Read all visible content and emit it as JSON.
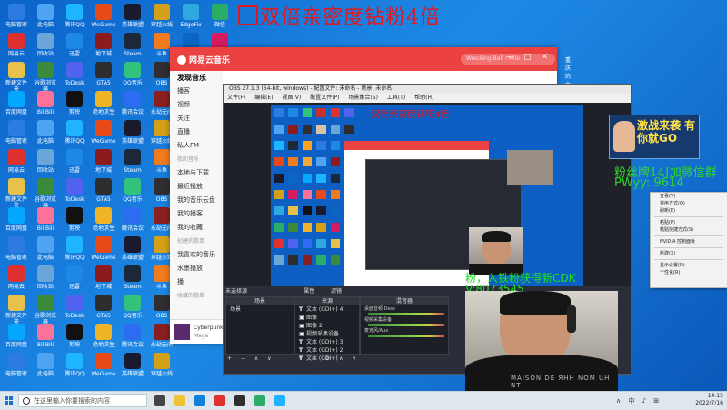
{
  "banner": {
    "text": "双倍亲密度钻粉4倍"
  },
  "desktop_icons": [
    {
      "label": "电脑管家",
      "color": "#2b7be0"
    },
    {
      "label": "此电脑",
      "color": "#4ea3f2"
    },
    {
      "label": "腾讯QQ",
      "color": "#1eb4ff"
    },
    {
      "label": "WeGame",
      "color": "#e64a19"
    },
    {
      "label": "英雄联盟",
      "color": "#1a1a2e"
    },
    {
      "label": "穿越火线",
      "color": "#d4a017"
    },
    {
      "label": "EdgeFix",
      "color": "#2fa8e0"
    },
    {
      "label": "微信",
      "color": "#2aae67"
    },
    {
      "label": "网易云",
      "color": "#e03131"
    },
    {
      "label": "回收站",
      "color": "#6aa6d8"
    },
    {
      "label": "迅雷",
      "color": "#1e88e5"
    },
    {
      "label": "地下城",
      "color": "#8c1c1c"
    },
    {
      "label": "Steam",
      "color": "#1b2838"
    },
    {
      "label": "斗鱼",
      "color": "#f27b1f"
    },
    {
      "label": "战网",
      "color": "#0a66c2"
    },
    {
      "label": "UU加速器",
      "color": "#d81b60"
    },
    {
      "label": "新建文件夹",
      "color": "#e8c14b"
    },
    {
      "label": "谷歌浏览器",
      "color": "#3a8a3a"
    },
    {
      "label": "ToDesk",
      "color": "#5063f0"
    },
    {
      "label": "GTA5",
      "color": "#2d2d2d"
    },
    {
      "label": "QQ音乐",
      "color": "#31c27c"
    },
    {
      "label": "OBS",
      "color": "#302e31"
    },
    {
      "label": "虎牙直播",
      "color": "#ffa31a"
    },
    {
      "label": "CS:GO",
      "color": "#f2a93b"
    },
    {
      "label": "百度网盘",
      "color": "#06a7ff"
    },
    {
      "label": "BiliBili",
      "color": "#fb7299"
    },
    {
      "label": "剪映",
      "color": "#111111"
    },
    {
      "label": "绝地求生",
      "color": "#f0b428"
    },
    {
      "label": "腾讯会议",
      "color": "#2d6cf0"
    },
    {
      "label": "永劫无间",
      "color": "#8a1f1f"
    },
    {
      "label": "APEX",
      "color": "#c9302c"
    },
    {
      "label": "原神",
      "color": "#d7c4a2"
    }
  ],
  "netease": {
    "app_title": "网易云音乐",
    "search_placeholder": "Wrecking Ball - Mile",
    "nav_label": "推荐",
    "user_name": "重庆的大吖",
    "sidebar": [
      "发现音乐",
      "播客",
      "视频",
      "关注",
      "直播",
      "私人FM"
    ],
    "my_music_title": "我的音乐",
    "my_music": [
      "本地与下载",
      "最近播放",
      "我的音乐云盘",
      "我的播客",
      "我的收藏"
    ],
    "created_title": "创建的歌单",
    "created": [
      "我喜欢的音乐",
      "水墨播放",
      "播"
    ],
    "collected_title": "收藏的歌单",
    "player_song": "Cyberpunk",
    "player_artist": "Maga"
  },
  "obs": {
    "title": "OBS 27.1.3 (64-bit, windows) - 配置文件: 未命名 - 场景: 未命名",
    "menu": [
      "文件(F)",
      "编辑(E)",
      "视图(V)",
      "配置文件(P)",
      "场景集合(S)",
      "工具(T)",
      "帮助(H)"
    ],
    "no_source": "未选择源",
    "tabs": [
      "属性",
      "滤镜"
    ],
    "scenes_title": "场景",
    "scenes": [
      "场景"
    ],
    "sources_title": "来源",
    "sources": [
      {
        "type": "T",
        "name": "文本 (GDI+) 4"
      },
      {
        "type": "▣",
        "name": "图像"
      },
      {
        "type": "▣",
        "name": "图像 2"
      },
      {
        "type": "▣",
        "name": "视频采集设备"
      },
      {
        "type": "T",
        "name": "文本 (GDI+) 3"
      },
      {
        "type": "T",
        "name": "文本 (GDI+) 2"
      },
      {
        "type": "T",
        "name": "文本 (GDI+)"
      }
    ],
    "mixer_title": "混音器",
    "mixer": [
      "桌面音频 Desk",
      "视频采集设备",
      "麦克风/Aux"
    ],
    "transition_title": "场景转换",
    "controls_title": "控制"
  },
  "promo": {
    "text": "激战来袭 有你就GO"
  },
  "overlay": {
    "fan_text": "粉丝牌14J加微信群",
    "pwyy": "PWyy:  9614",
    "cdk": "粉，入铁粉获得新CDK",
    "vcode": "V:8073545"
  },
  "context_menu": [
    "查看(V)",
    "排序方式(O)",
    "刷新(E)",
    "粘贴(P)",
    "粘贴快捷方式(S)",
    "NVIDIA 控制面板",
    "新建(X)",
    "显示设置(D)",
    "个性化(R)"
  ],
  "camera": {
    "shirt_text": "MAISON DE  ЯHH NOM UH NT"
  },
  "taskbar": {
    "search_placeholder": "在这里输入你要搜索的内容",
    "time": "14:15",
    "date": "2022/7/16",
    "tray": "∧ 中 ♪ ⊞"
  }
}
